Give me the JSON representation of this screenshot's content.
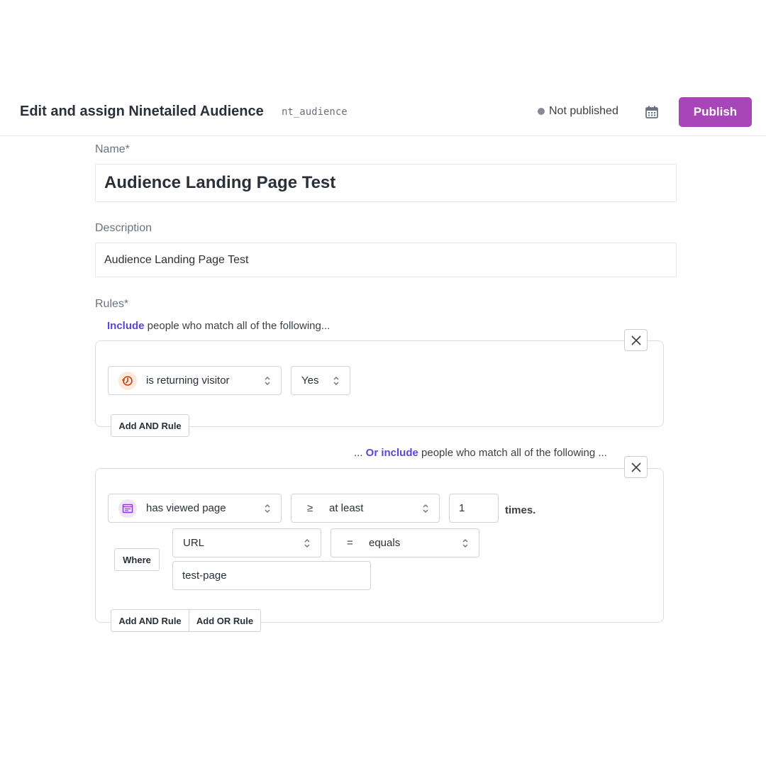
{
  "header": {
    "title": "Edit and assign Ninetailed Audience",
    "content_type_id": "nt_audience",
    "status": "Not published",
    "calendar_icon": "calendar-icon",
    "publish_label": "Publish",
    "publish_color": "#a845b8"
  },
  "form": {
    "name_label": "Name*",
    "name_value": "Audience Landing Page Test",
    "description_label": "Description",
    "description_value": "Audience Landing Page Test",
    "rules_label": "Rules*"
  },
  "rules": {
    "accent_color": "#5b46d6",
    "group1": {
      "heading_keyword": "Include",
      "heading_text": " people who match all of the following...",
      "condition": {
        "icon": "returning-visitor-icon",
        "label": "is returning visitor",
        "value": "Yes"
      },
      "add_and_label": "Add AND Rule"
    },
    "group2": {
      "heading_prefix": "... ",
      "heading_keyword": "Or include",
      "heading_text": " people who match all of the following ...",
      "condition": {
        "icon": "page-view-icon",
        "label": "has viewed page",
        "operator_symbol": "≥",
        "operator_label": "at least",
        "count": "1",
        "count_suffix": "times."
      },
      "where": {
        "label": "Where",
        "property": "URL",
        "comparator_symbol": "=",
        "comparator_label": "equals",
        "value": "test-page"
      },
      "add_and_label": "Add AND Rule",
      "add_or_label": "Add OR Rule"
    }
  }
}
